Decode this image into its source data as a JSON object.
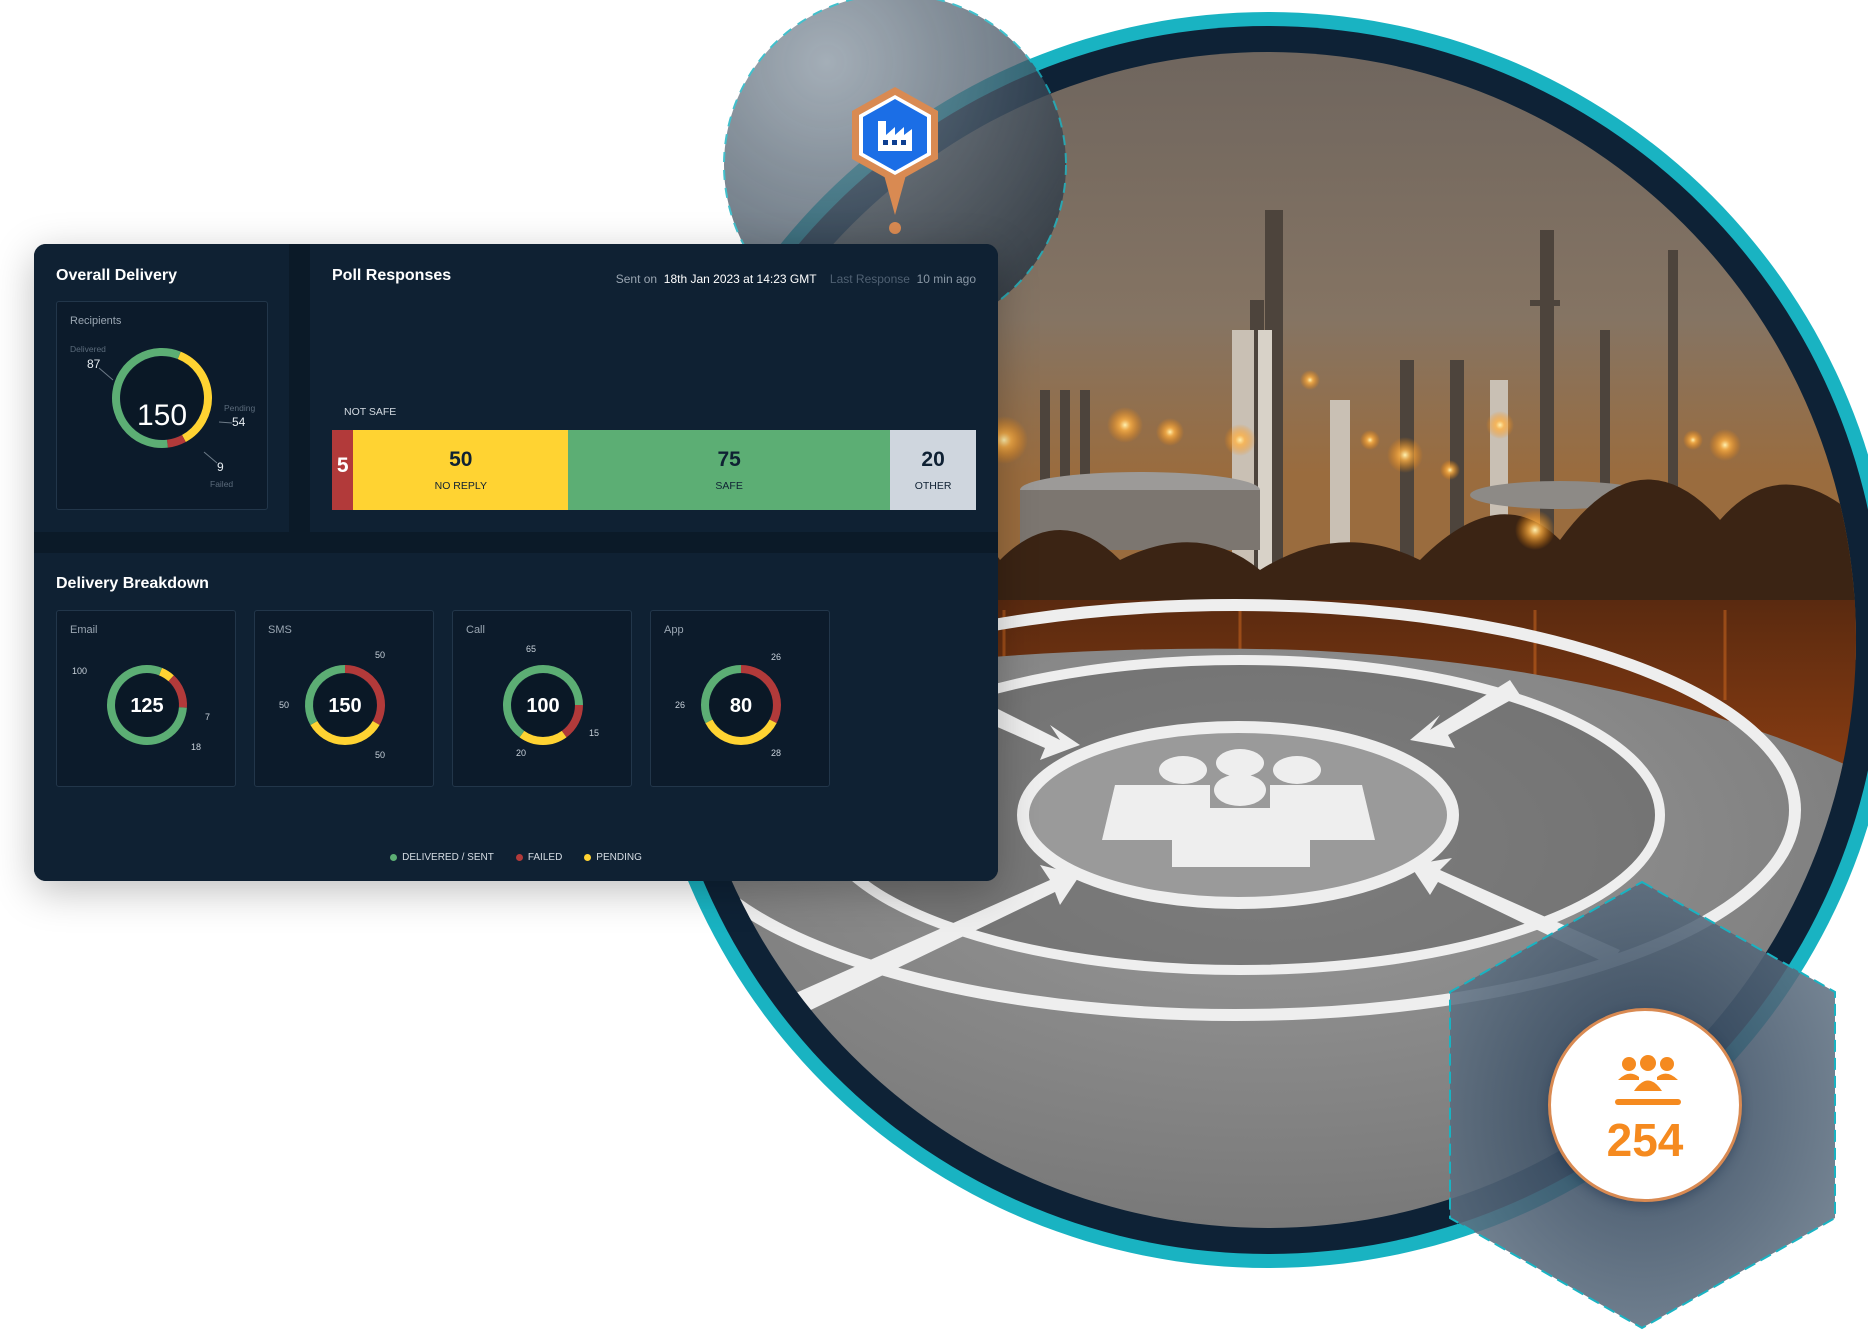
{
  "colors": {
    "delivered": "#5cae74",
    "failed": "#b23a3a",
    "pending": "#ffd332",
    "other": "#cfd6de",
    "panel_bg": "#0f2133",
    "teal": "#19b3c2",
    "navy": "#0e2236",
    "orange": "#f58a1f",
    "pin_blue": "#1b6ee6",
    "pin_orange": "#d98a52"
  },
  "overall_delivery": {
    "title": "Overall Delivery",
    "card_label": "Recipients",
    "total": "150",
    "delivered": {
      "label": "Delivered",
      "value": 87
    },
    "pending": {
      "label": "Pending",
      "value": 54
    },
    "failed": {
      "label": "Failed",
      "value": 9
    }
  },
  "poll_responses": {
    "title": "Poll Responses",
    "sent_on_label": "Sent on",
    "sent_on_value": "18th Jan 2023 at 14:23 GMT",
    "last_response_label": "Last Response",
    "last_response_value": "10 min ago",
    "not_safe_label": "NOT SAFE",
    "segments": [
      {
        "key": "not_safe",
        "value": 5,
        "label": ""
      },
      {
        "key": "no_reply",
        "value": 50,
        "label": "NO REPLY"
      },
      {
        "key": "safe",
        "value": 75,
        "label": "SAFE"
      },
      {
        "key": "other",
        "value": 20,
        "label": "OTHER"
      }
    ]
  },
  "delivery_breakdown": {
    "title": "Delivery Breakdown",
    "channels": [
      {
        "name": "Email",
        "total": "125",
        "delivered": 100,
        "pending": 7,
        "failed": 18
      },
      {
        "name": "SMS",
        "total": "150",
        "delivered": 50,
        "failed": 50,
        "pending": 50
      },
      {
        "name": "Call",
        "total": "100",
        "delivered": 65,
        "failed": 15,
        "pending": 20
      },
      {
        "name": "App",
        "total": "80",
        "delivered": 26,
        "failed": 26,
        "pending": 28
      }
    ],
    "legend": [
      {
        "key": "delivered",
        "label": "DELIVERED / SENT"
      },
      {
        "key": "failed",
        "label": "FAILED"
      },
      {
        "key": "pending",
        "label": "PENDING"
      }
    ]
  },
  "badge": {
    "icon": "group-icon",
    "count": "254"
  },
  "location_pin": {
    "icon": "factory-icon"
  },
  "photo": {
    "subject": "refinery-at-night-with-assembly-point-marking"
  }
}
